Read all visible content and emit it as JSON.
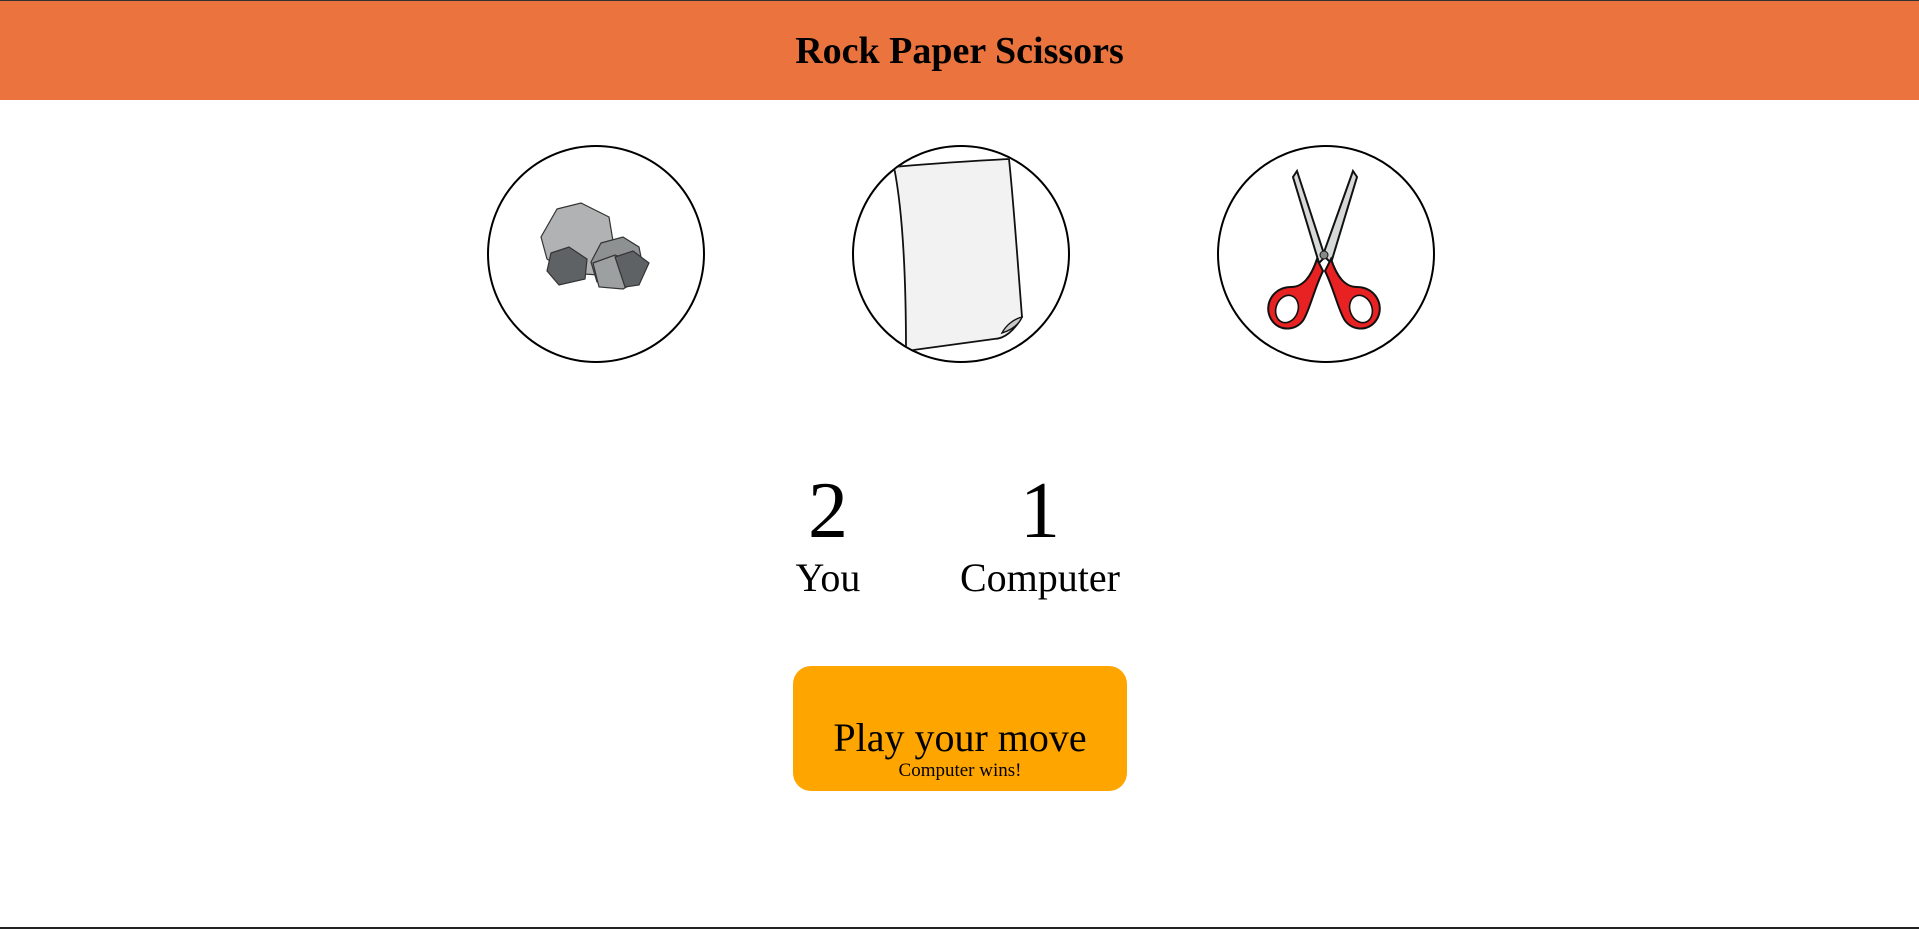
{
  "header": {
    "title": "Rock Paper Scissors",
    "background_color": "#ea733e"
  },
  "choices": [
    {
      "id": "rock",
      "icon": "rock-icon"
    },
    {
      "id": "paper",
      "icon": "paper-icon"
    },
    {
      "id": "scissors",
      "icon": "scissors-icon"
    }
  ],
  "scores": {
    "you": {
      "value": "2",
      "label": "You"
    },
    "computer": {
      "value": "1",
      "label": "Computer"
    }
  },
  "play_button": {
    "label": "Play your move",
    "result": "Computer wins!",
    "background_color": "#ffa500"
  }
}
